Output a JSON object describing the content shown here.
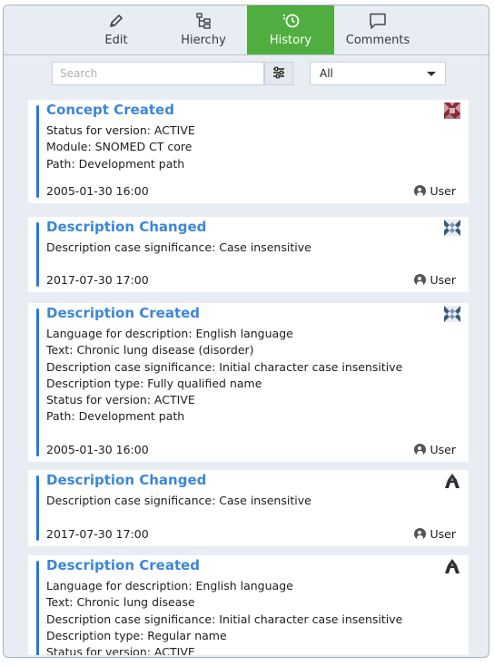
{
  "tabs": [
    {
      "label": "Edit",
      "icon": "pencil-icon"
    },
    {
      "label": "Hierchy",
      "icon": "hierarchy-icon"
    },
    {
      "label": "History",
      "icon": "history-icon",
      "active": true
    },
    {
      "label": "Comments",
      "icon": "comment-icon"
    }
  ],
  "search": {
    "placeholder": "Search",
    "value": ""
  },
  "filter_select": {
    "selected": "All"
  },
  "colors": {
    "accent_green": "#4fae3f",
    "title_blue": "#3c87d6",
    "bar_blue": "#1f7ce0"
  },
  "history": [
    {
      "title": "Concept Created",
      "lines": [
        "Status for version: ACTIVE",
        "Module: SNOMED CT core",
        "Path: Development path"
      ],
      "date": "2005-01-30 16:00",
      "user": "User",
      "badge_icon": "red-pattern-avatar-icon"
    },
    {
      "title": "Description Changed",
      "lines": [
        "Description case significance: Case insensitive"
      ],
      "date": "2017-07-30 17:00",
      "user": "User",
      "badge_icon": "blue-pattern-avatar-icon"
    },
    {
      "title": "Description Created",
      "lines": [
        "Language for description: English language",
        "Text: Chronic lung disease (disorder)",
        "Description case significance: Initial character case insensitive",
        "Description type: Fully qualified name",
        "Status for version: ACTIVE",
        "Path: Development path"
      ],
      "date": "2005-01-30 16:00",
      "user": "User",
      "badge_icon": "blue-pattern-avatar-icon"
    },
    {
      "title": "Description Changed",
      "lines": [
        "Description case significance: Case insensitive"
      ],
      "date": "2017-07-30 17:00",
      "user": "User",
      "badge_icon": "dark-pattern-avatar-icon"
    },
    {
      "title": "Description Created",
      "lines": [
        "Language for description: English language",
        "Text: Chronic lung disease",
        "Description case significance: Initial character case insensitive",
        "Description type: Regular name",
        "Status for version: ACTIVE"
      ],
      "date": "",
      "user": "",
      "badge_icon": "dark-pattern-avatar-icon"
    }
  ]
}
